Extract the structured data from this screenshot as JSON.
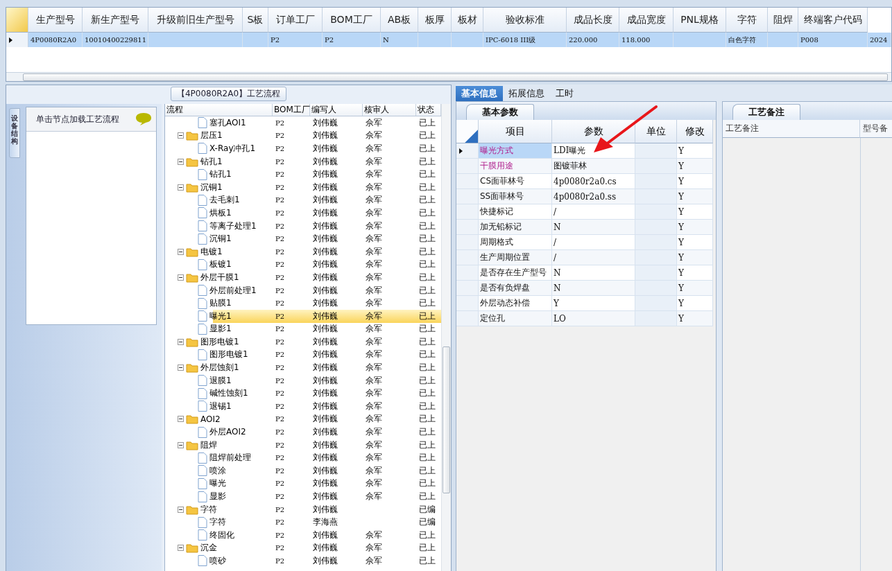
{
  "top_grid": {
    "columns": [
      "生产型号",
      "新生产型号",
      "升级前旧生产型号",
      "S板",
      "订单工厂",
      "BOM工厂",
      "AB板",
      "板厚",
      "板材",
      "验收标准",
      "成品长度",
      "成品宽度",
      "PNL规格",
      "字符",
      "阻焊",
      "终端客户代码"
    ],
    "rows": [
      {
        "selected": true,
        "cells": [
          "4P0080R2A0",
          "10010400229811",
          null,
          null,
          "P2",
          "P2",
          "N",
          null,
          null,
          "IPC-6018 III级",
          "220.000",
          "118.000",
          null,
          "白色字符",
          null,
          "P008",
          "2024"
        ]
      }
    ]
  },
  "flow_panel": {
    "title": "【4P0080R2A0】工艺流程",
    "side_tab": "设备结构",
    "hint": "单击节点加载工艺流程",
    "tree": {
      "columns": [
        "流程",
        "BOM工厂",
        "编写人",
        "核审人",
        "状态"
      ],
      "nodes": [
        {
          "kind": "continued",
          "children": [
            {
              "kind": "file",
              "label": "塞孔AOI1",
              "bom": "P2",
              "writer": "刘伟巍",
              "reviewer": "佘军",
              "status": "已上",
              "selected": false
            }
          ]
        },
        {
          "kind": "folder",
          "expanded": true,
          "label": "层压1",
          "bom": "P2",
          "writer": "刘伟巍",
          "reviewer": "佘军",
          "status": "已上",
          "selected": false,
          "children": [
            {
              "kind": "file",
              "label": "X-Ray冲孔1",
              "bom": "P2",
              "writer": "刘伟巍",
              "reviewer": "佘军",
              "status": "已上",
              "selected": false
            }
          ]
        },
        {
          "kind": "folder",
          "expanded": true,
          "label": "钻孔1",
          "bom": "P2",
          "writer": "刘伟巍",
          "reviewer": "佘军",
          "status": "已上",
          "selected": false,
          "children": [
            {
              "kind": "file",
              "label": "钻孔1",
              "bom": "P2",
              "writer": "刘伟巍",
              "reviewer": "佘军",
              "status": "已上",
              "selected": false
            }
          ]
        },
        {
          "kind": "folder",
          "expanded": true,
          "label": "沉铜1",
          "bom": "P2",
          "writer": "刘伟巍",
          "reviewer": "佘军",
          "status": "已上",
          "selected": false,
          "children": [
            {
              "kind": "file",
              "label": "去毛刺1",
              "bom": "P2",
              "writer": "刘伟巍",
              "reviewer": "佘军",
              "status": "已上",
              "selected": false
            },
            {
              "kind": "file",
              "label": "烘板1",
              "bom": "P2",
              "writer": "刘伟巍",
              "reviewer": "佘军",
              "status": "已上",
              "selected": false
            },
            {
              "kind": "file",
              "label": "等离子处理1",
              "bom": "P2",
              "writer": "刘伟巍",
              "reviewer": "佘军",
              "status": "已上",
              "selected": false
            },
            {
              "kind": "file",
              "label": "沉铜1",
              "bom": "P2",
              "writer": "刘伟巍",
              "reviewer": "佘军",
              "status": "已上",
              "selected": false
            }
          ]
        },
        {
          "kind": "folder",
          "expanded": true,
          "label": "电镀1",
          "bom": "P2",
          "writer": "刘伟巍",
          "reviewer": "佘军",
          "status": "已上",
          "selected": false,
          "children": [
            {
              "kind": "file",
              "label": "板镀1",
              "bom": "P2",
              "writer": "刘伟巍",
              "reviewer": "佘军",
              "status": "已上",
              "selected": false
            }
          ]
        },
        {
          "kind": "folder",
          "expanded": true,
          "label": "外层干膜1",
          "bom": "P2",
          "writer": "刘伟巍",
          "reviewer": "佘军",
          "status": "已上",
          "selected": false,
          "children": [
            {
              "kind": "file",
              "label": "外层前处理1",
              "bom": "P2",
              "writer": "刘伟巍",
              "reviewer": "佘军",
              "status": "已上",
              "selected": false
            },
            {
              "kind": "file",
              "label": "贴膜1",
              "bom": "P2",
              "writer": "刘伟巍",
              "reviewer": "佘军",
              "status": "已上",
              "selected": false
            },
            {
              "kind": "file",
              "label": "曝光1",
              "bom": "P2",
              "writer": "刘伟巍",
              "reviewer": "佘军",
              "status": "已上",
              "selected": true
            },
            {
              "kind": "file",
              "label": "显影1",
              "bom": "P2",
              "writer": "刘伟巍",
              "reviewer": "佘军",
              "status": "已上",
              "selected": false
            }
          ]
        },
        {
          "kind": "folder",
          "expanded": true,
          "label": "图形电镀1",
          "bom": "P2",
          "writer": "刘伟巍",
          "reviewer": "佘军",
          "status": "已上",
          "selected": false,
          "children": [
            {
              "kind": "file",
              "label": "图形电镀1",
              "bom": "P2",
              "writer": "刘伟巍",
              "reviewer": "佘军",
              "status": "已上",
              "selected": false
            }
          ]
        },
        {
          "kind": "folder",
          "expanded": true,
          "label": "外层蚀刻1",
          "bom": "P2",
          "writer": "刘伟巍",
          "reviewer": "佘军",
          "status": "已上",
          "selected": false,
          "children": [
            {
              "kind": "file",
              "label": "退膜1",
              "bom": "P2",
              "writer": "刘伟巍",
              "reviewer": "佘军",
              "status": "已上",
              "selected": false
            },
            {
              "kind": "file",
              "label": "碱性蚀刻1",
              "bom": "P2",
              "writer": "刘伟巍",
              "reviewer": "佘军",
              "status": "已上",
              "selected": false
            },
            {
              "kind": "file",
              "label": "退锡1",
              "bom": "P2",
              "writer": "刘伟巍",
              "reviewer": "佘军",
              "status": "已上",
              "selected": false
            }
          ]
        },
        {
          "kind": "folder",
          "expanded": true,
          "label": "AOI2",
          "bom": "P2",
          "writer": "刘伟巍",
          "reviewer": "佘军",
          "status": "已上",
          "selected": false,
          "children": [
            {
              "kind": "file",
              "label": "外层AOI2",
              "bom": "P2",
              "writer": "刘伟巍",
              "reviewer": "佘军",
              "status": "已上",
              "selected": false
            }
          ]
        },
        {
          "kind": "folder",
          "expanded": true,
          "label": "阻焊",
          "bom": "P2",
          "writer": "刘伟巍",
          "reviewer": "佘军",
          "status": "已上",
          "selected": false,
          "children": [
            {
              "kind": "file",
              "label": "阻焊前处理",
              "bom": "P2",
              "writer": "刘伟巍",
              "reviewer": "佘军",
              "status": "已上",
              "selected": false
            },
            {
              "kind": "file",
              "label": "喷涂",
              "bom": "P2",
              "writer": "刘伟巍",
              "reviewer": "佘军",
              "status": "已上",
              "selected": false
            },
            {
              "kind": "file",
              "label": "曝光",
              "bom": "P2",
              "writer": "刘伟巍",
              "reviewer": "佘军",
              "status": "已上",
              "selected": false
            },
            {
              "kind": "file",
              "label": "显影",
              "bom": "P2",
              "writer": "刘伟巍",
              "reviewer": "佘军",
              "status": "已上",
              "selected": false
            }
          ]
        },
        {
          "kind": "folder",
          "expanded": true,
          "label": "字符",
          "bom": "P2",
          "writer": "刘伟巍",
          "status": "已编",
          "selected": false,
          "children": [
            {
              "kind": "file",
              "label": "字符",
              "bom": "P2",
              "writer": "李海燕",
              "status": "已编",
              "selected": false
            },
            {
              "kind": "file",
              "label": "终固化",
              "bom": "P2",
              "writer": "刘伟巍",
              "reviewer": "佘军",
              "status": "已上",
              "selected": false
            }
          ]
        },
        {
          "kind": "folder",
          "expanded": true,
          "label": "沉金",
          "bom": "P2",
          "writer": "刘伟巍",
          "reviewer": "佘军",
          "status": "已上",
          "selected": false,
          "children": [
            {
              "kind": "file",
              "label": "喷砂",
              "bom": "P2",
              "writer": "刘伟巍",
              "reviewer": "佘军",
              "status": "已上",
              "selected": false
            }
          ]
        }
      ]
    }
  },
  "detail": {
    "tabs": [
      {
        "label": "基本信息",
        "selected": true
      },
      {
        "label": "拓展信息",
        "selected": false
      },
      {
        "label": "工时",
        "selected": false
      }
    ],
    "params": {
      "title": "基本参数",
      "columns": [
        "项目",
        "参数",
        "单位",
        "修改"
      ],
      "rows": [
        {
          "item": "曝光方式",
          "value": "LDI曝光",
          "modified": "Y",
          "required": true,
          "selected": true
        },
        {
          "item": "干膜用途",
          "value": "图镀菲林",
          "modified": "Y",
          "required": true,
          "selected": false
        },
        {
          "item": "CS面菲林号",
          "value": "4p0080r2a0.cs",
          "modified": "Y",
          "required": false,
          "selected": false
        },
        {
          "item": "SS面菲林号",
          "value": "4p0080r2a0.ss",
          "modified": "Y",
          "required": false,
          "selected": false
        },
        {
          "item": "快捷标记",
          "value": "/",
          "modified": "Y",
          "required": false,
          "selected": false
        },
        {
          "item": "加无铅标记",
          "value": "N",
          "modified": "Y",
          "required": false,
          "selected": false
        },
        {
          "item": "周期格式",
          "value": "/",
          "modified": "Y",
          "required": false,
          "selected": false
        },
        {
          "item": "生产周期位置",
          "value": "/",
          "modified": "Y",
          "required": false,
          "selected": false
        },
        {
          "item": "是否存在生产型号",
          "value": "N",
          "modified": "Y",
          "required": false,
          "selected": false
        },
        {
          "item": "是否有负焊盘",
          "value": "N",
          "modified": "Y",
          "required": false,
          "selected": false
        },
        {
          "item": "外层动态补偿",
          "value": "Y",
          "modified": "Y",
          "required": false,
          "selected": false
        },
        {
          "item": "定位孔",
          "value": "LO",
          "modified": "Y",
          "required": false,
          "selected": false
        }
      ]
    },
    "notes": {
      "title": "工艺备注",
      "columns": [
        "工艺备注",
        "型号备"
      ]
    }
  }
}
